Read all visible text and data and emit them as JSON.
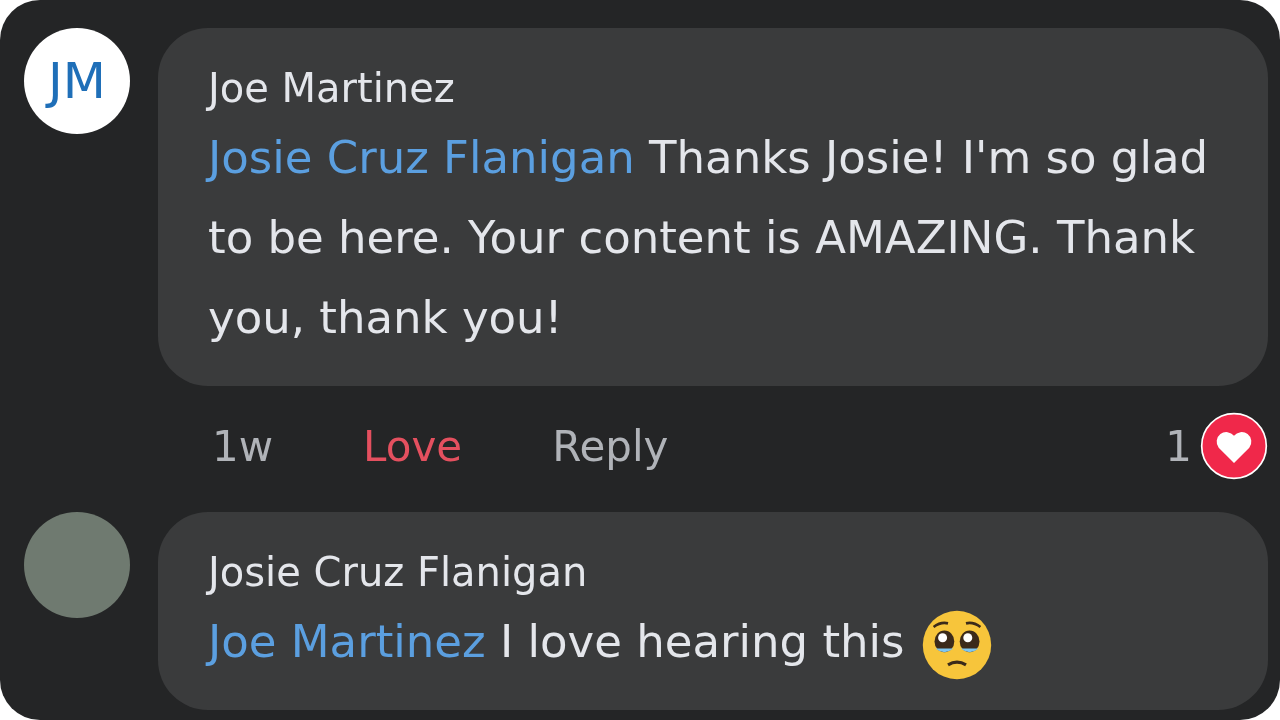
{
  "comments": [
    {
      "author": "Joe Martinez",
      "avatar": {
        "kind": "initials",
        "text": "JM"
      },
      "mention": "Josie Cruz Flanigan",
      "text": "Thanks Josie! I'm so glad to be here. Your content is AMAZING. Thank you, thank you!",
      "trailing_emoji": false,
      "meta": {
        "time": "1w",
        "love": {
          "label": "Love",
          "selected": true
        },
        "reply": "Reply",
        "reaction_count": "1"
      }
    },
    {
      "author": "Josie Cruz Flanigan",
      "avatar": {
        "kind": "photo"
      },
      "mention": "Joe Martinez",
      "text": "I love hearing this",
      "trailing_emoji": true
    }
  ]
}
